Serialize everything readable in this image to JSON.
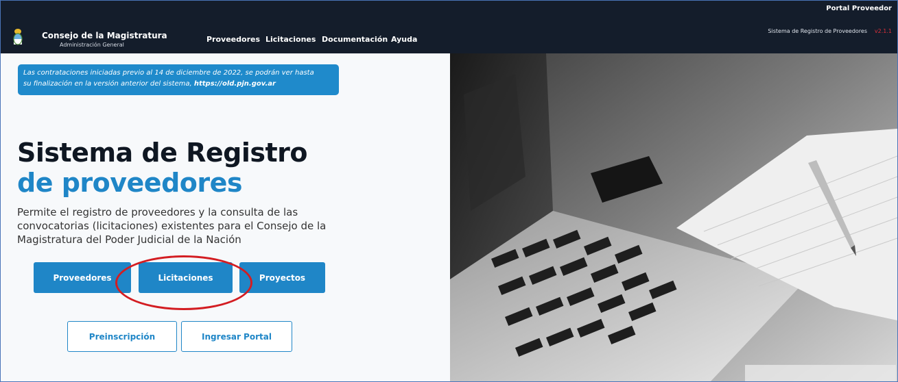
{
  "header": {
    "brand_title": "Consejo de la Magistratura",
    "brand_subtitle": "Administración General",
    "nav": [
      "Proveedores",
      "Licitaciones",
      "Documentación",
      "Ayuda"
    ],
    "portal_label": "Portal Proveedor",
    "system_label": "Sistema de Registro de Proveedores",
    "version": "v2.1.1"
  },
  "notice": {
    "text_line1": "Las contrataciones iniciadas previo al 14 de diciembre de 2022, se podrán ver hasta",
    "text_line2": "su finalización en la versión anterior del sistema, ",
    "link": "https://old.pjn.gov.ar"
  },
  "hero": {
    "title_line1": "Sistema de Registro",
    "title_line2": "de proveedores",
    "description": "Permite el registro de proveedores y la consulta de las convocatorias (licitaciones) existentes para el Consejo de la Magistratura del Poder Judicial de la Nación"
  },
  "buttons": {
    "proveedores": "Proveedores",
    "licitaciones": "Licitaciones",
    "proyectos": "Proyectos",
    "preinscripcion": "Preinscripción",
    "ingresar": "Ingresar Portal"
  },
  "colors": {
    "topbar": "#141d2b",
    "accent": "#1f86c7",
    "version": "#e0303a",
    "highlight": "#d31d22"
  }
}
